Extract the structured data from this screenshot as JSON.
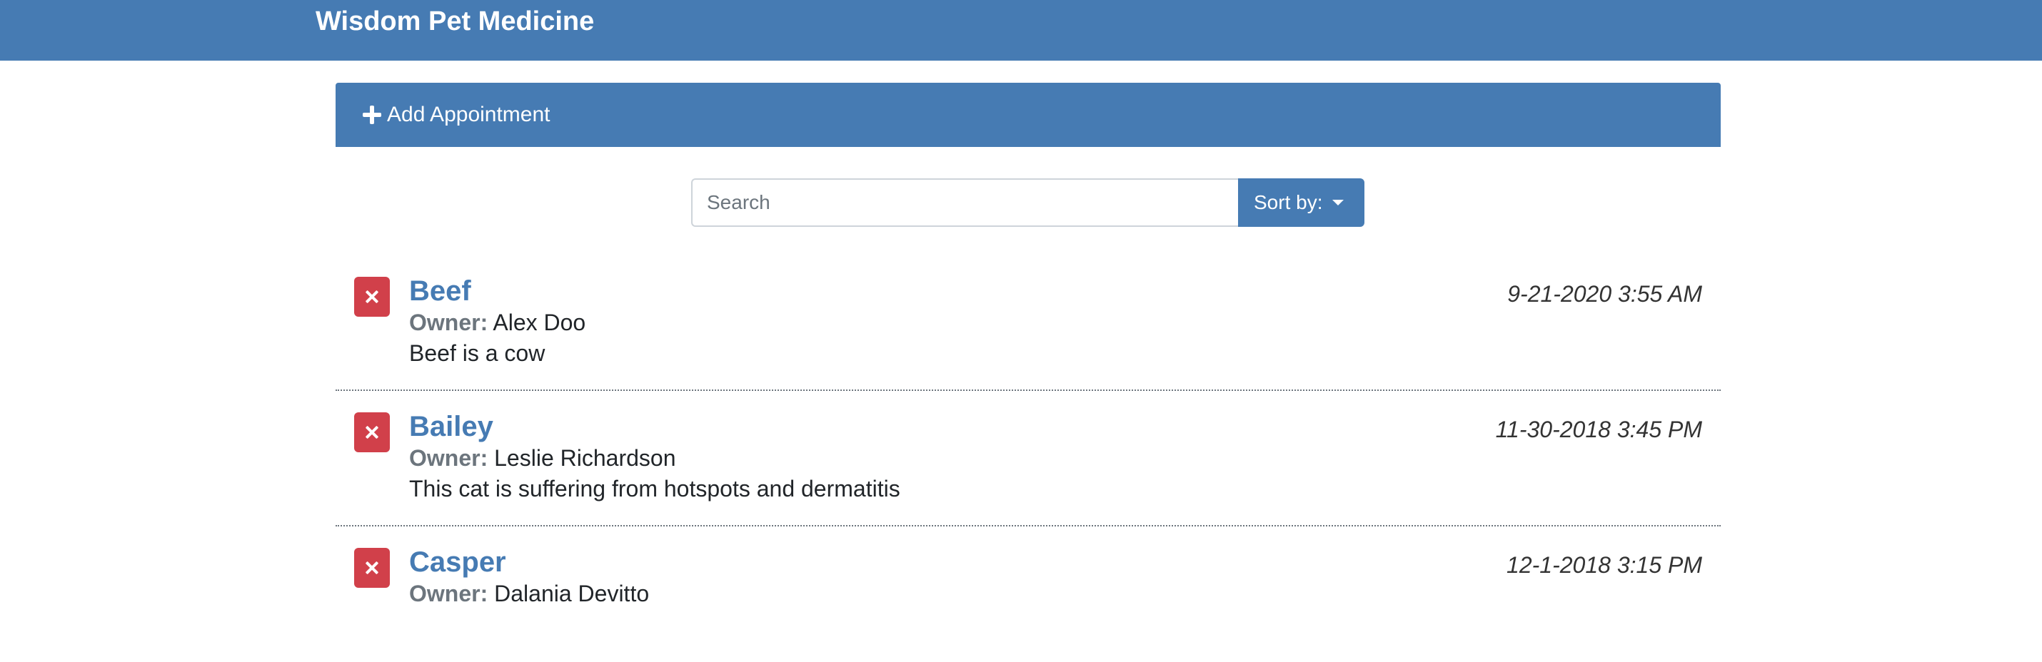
{
  "app": {
    "title": "Wisdom Pet Medicine"
  },
  "add_appointment": {
    "label": "Add Appointment",
    "icon": "plus-icon"
  },
  "search": {
    "placeholder": "Search",
    "value": ""
  },
  "sort": {
    "label": "Sort by:",
    "icon": "caret-down-icon"
  },
  "colors": {
    "primary": "#467bb3",
    "danger": "#d1404a"
  },
  "appointments": [
    {
      "pet_name": "Beef",
      "date": "9-21-2020 3:55 AM",
      "owner_label": "Owner:",
      "owner": "Alex Doo",
      "notes": "Beef is a cow"
    },
    {
      "pet_name": "Bailey",
      "date": "11-30-2018 3:45 PM",
      "owner_label": "Owner:",
      "owner": "Leslie Richardson",
      "notes": "This cat is suffering from hotspots and dermatitis"
    },
    {
      "pet_name": "Casper",
      "date": "12-1-2018 3:15 PM",
      "owner_label": "Owner:",
      "owner": "Dalania Devitto",
      "notes": ""
    }
  ]
}
